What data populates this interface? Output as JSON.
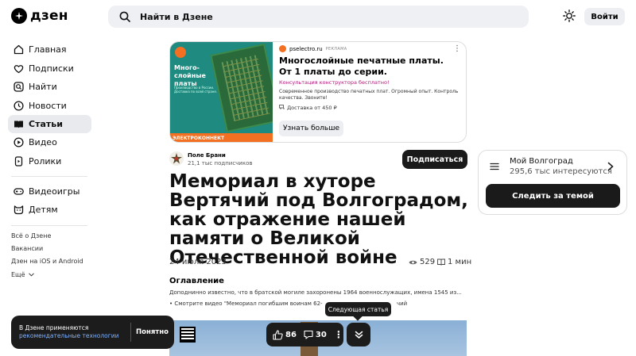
{
  "header": {
    "logo_text": "дзен",
    "search_placeholder": "Найти в Дзене",
    "login_label": "Войти"
  },
  "sidebar": {
    "items": [
      {
        "label": "Главная",
        "icon": "home-icon"
      },
      {
        "label": "Подписки",
        "icon": "subscriptions-icon"
      },
      {
        "label": "Найти",
        "icon": "search-icon"
      },
      {
        "label": "Новости",
        "icon": "news-icon"
      },
      {
        "label": "Статьи",
        "icon": "articles-icon",
        "active": true
      },
      {
        "label": "Видео",
        "icon": "video-icon"
      },
      {
        "label": "Ролики",
        "icon": "shorts-icon"
      },
      {
        "label": "Видеоигры",
        "icon": "gamepad-icon"
      },
      {
        "label": "Детям",
        "icon": "kids-icon"
      }
    ],
    "links": [
      "Всё о Дзене",
      "Вакансии",
      "Дзен на iOS и Android"
    ],
    "more_label": "Ещё"
  },
  "ad": {
    "domain": "pselectro.ru",
    "tag": "РЕКЛАМА",
    "title": "Многослойные печатные платы. От 1 платы до серии.",
    "promo": "Консультация конструктора бесплатно!",
    "description": "Современное производство печатных плат. Огромный опыт. Контроль качества. Звоните!",
    "price": "Доставка от 450 ₽",
    "button_label": "Узнать больше",
    "image_title": "Много-\nслойные\nплаты",
    "image_sub": "Производство в России. Доставка по всей стране.",
    "image_brand": "ЭЛЕКТРОКОННЕКТ"
  },
  "article": {
    "channel_name": "Поле Брани",
    "channel_subs": "21,1 тыс подписчиков",
    "subscribe_label": "Подписаться",
    "title": "Мемориал в хуторе Вертячий под Волгоградом, как отражение нашей памяти о Великой Отечественной войне",
    "date": "24 июля 2023",
    "views": "529",
    "read_time": "1 мин",
    "toc_title": "Оглавление",
    "toc_items": [
      "Доподнинно известно, что в братской могиле захоронены 1964 военнослужащих, имена 1545 из...",
      "• Смотрите видео \"Мемориал погибшим воинам 62-",
      "чий"
    ]
  },
  "topic": {
    "name": "Мой Волгоград",
    "subs": "295,6 тыс интересуются",
    "follow_label": "Следить за темой"
  },
  "cookie": {
    "text": "В Дзене применяются",
    "link": "рекомендательные технологии",
    "ok_label": "Понятно"
  },
  "floating": {
    "likes": "86",
    "comments": "30",
    "next_tooltip": "Следующая статья"
  },
  "colors": {
    "accent_dark": "#1a1a1a",
    "ad_orange": "#f36f21",
    "promo_magenta": "#b01a7a",
    "link_blue": "#7fb2ff"
  }
}
